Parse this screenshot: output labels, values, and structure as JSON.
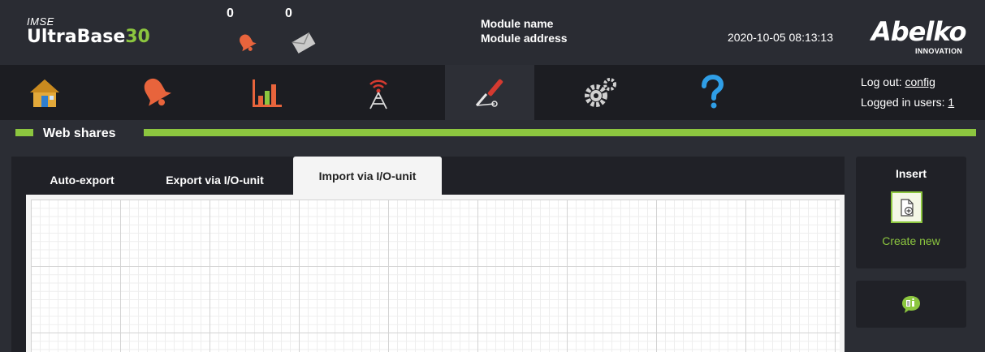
{
  "app": {
    "vendor_label": "IMSE",
    "product_name": "UltraBase",
    "product_number": "30"
  },
  "counters": {
    "alarms": "0",
    "messages": "0"
  },
  "module": {
    "name": "Module name",
    "address": "Module address"
  },
  "datetime": "2020-10-05 08:13:13",
  "brand": {
    "name": "Abelko",
    "sub": "INNOVATION"
  },
  "nav": {
    "items": [
      {
        "icon": "home-icon"
      },
      {
        "icon": "alarm-bell-icon"
      },
      {
        "icon": "bar-chart-icon"
      },
      {
        "icon": "antenna-icon"
      },
      {
        "icon": "tools-icon",
        "active": true
      },
      {
        "icon": "settings-gears-icon"
      },
      {
        "icon": "help-icon"
      }
    ]
  },
  "auth": {
    "logout_prefix": "Log out:",
    "user": "config",
    "logged_in_prefix": "Logged in users:",
    "logged_in_count": "1"
  },
  "section": {
    "title": "Web shares"
  },
  "tabs": [
    {
      "label": "Auto-export"
    },
    {
      "label": "Export via I/O-unit"
    },
    {
      "label": "Import via I/O-unit",
      "active": true
    }
  ],
  "sidebar": {
    "title": "Insert",
    "create_label": "Create new"
  },
  "colors": {
    "accent": "#8cc63f",
    "background": "#2b2d34",
    "panel": "#202127",
    "nav": "#1c1d22"
  }
}
